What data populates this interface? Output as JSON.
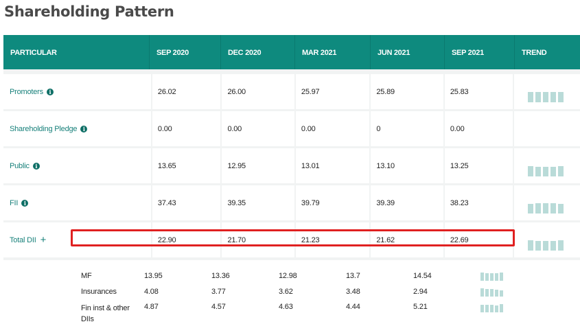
{
  "title": "Shareholding Pattern",
  "columns": [
    "PARTICULAR",
    "SEP 2020",
    "DEC 2020",
    "MAR 2021",
    "JUN 2021",
    "SEP 2021",
    "TREND"
  ],
  "rows": [
    {
      "name": "Promoters",
      "icon": "info-icon",
      "values": [
        "26.02",
        "26.00",
        "25.97",
        "25.89",
        "25.83"
      ],
      "trend": [
        26.02,
        26.0,
        25.97,
        25.89,
        25.83
      ]
    },
    {
      "name": "Shareholding Pledge",
      "icon": "info-icon",
      "values": [
        "0.00",
        "0.00",
        "0.00",
        "0",
        "0.00"
      ],
      "trend": []
    },
    {
      "name": "Public",
      "icon": "info-icon",
      "values": [
        "13.65",
        "12.95",
        "13.01",
        "13.10",
        "13.25"
      ],
      "trend": [
        13.65,
        12.95,
        13.01,
        13.1,
        13.25
      ]
    },
    {
      "name": "FII",
      "icon": "info-icon",
      "values": [
        "37.43",
        "39.35",
        "39.79",
        "39.39",
        "38.23"
      ],
      "trend": [
        37.43,
        39.35,
        39.79,
        39.39,
        38.23
      ]
    },
    {
      "name": "Total DII",
      "icon": "plus-icon",
      "values": [
        "22.90",
        "21.70",
        "21.23",
        "21.62",
        "22.69"
      ],
      "trend": [
        22.9,
        21.7,
        21.23,
        21.62,
        22.69
      ]
    }
  ],
  "sub_rows": [
    {
      "name": "MF",
      "values": [
        "13.95",
        "13.36",
        "12.98",
        "13.7",
        "14.54"
      ],
      "trend": [
        13.95,
        13.36,
        12.98,
        13.7,
        14.54
      ],
      "highlighted": true
    },
    {
      "name": "Insurances",
      "values": [
        "4.08",
        "3.77",
        "3.62",
        "3.48",
        "2.94"
      ],
      "trend": [
        4.08,
        3.77,
        3.62,
        3.48,
        2.94
      ]
    },
    {
      "name": "Fin inst & other DIIs",
      "values": [
        "4.87",
        "4.57",
        "4.63",
        "4.44",
        "5.21"
      ],
      "trend": [
        4.87,
        4.57,
        4.63,
        4.44,
        5.21
      ]
    }
  ],
  "colors": {
    "header": "#0e8a7e",
    "name_text": "#17807a",
    "trend_bar": "#b9dbd8",
    "highlight": "#e02020"
  }
}
